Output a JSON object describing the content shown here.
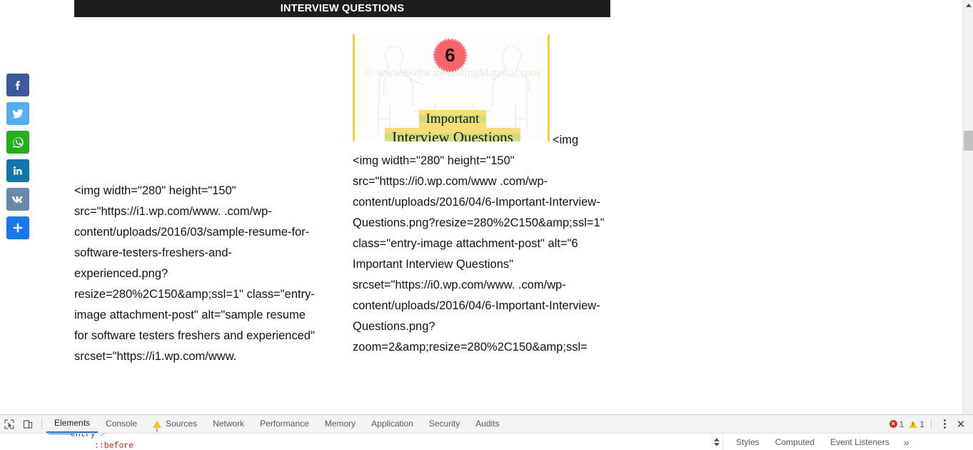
{
  "banner": {
    "title": "INTERVIEW QUESTIONS"
  },
  "social": {
    "items": [
      {
        "name": "facebook",
        "label": "Facebook",
        "color": "#3b5998",
        "glyph": "f"
      },
      {
        "name": "twitter",
        "label": "Twitter",
        "color": "#55acee",
        "glyph": "t"
      },
      {
        "name": "whatsapp",
        "label": "WhatsApp",
        "color": "#25af20",
        "glyph": "w"
      },
      {
        "name": "linkedin",
        "label": "LinkedIn",
        "color": "#0e76a8",
        "glyph": "in"
      },
      {
        "name": "vk",
        "label": "VK",
        "color": "#6989a8",
        "glyph": "vk"
      },
      {
        "name": "share-more",
        "label": "Share",
        "color": "#1877f2",
        "glyph": "+"
      }
    ]
  },
  "featured_image": {
    "alt": "6 Important Interview Questions",
    "badge_number": "6",
    "headline_line1": "Important",
    "headline_line2": "Interview Questions",
    "watermark": "© www.SoftwareTestingMaterial.com",
    "frame_color": "#f5d331",
    "badge_color": "#f9646b",
    "highlight_color": "#f7de74"
  },
  "code_left": {
    "lines": [
      "<img width=\"280\" height=\"150\"",
      "src=\"https://i1.wp.com/www.",
      "        .com/wp-",
      "content/uploads/2016/03/sample-resume-",
      "for-software-testers-freshers-and-",
      "experienced.png?",
      "resize=280%2C150&amp;ssl=1\"",
      "class=\"entry-image attachment-post\"",
      "alt=\"sample resume for software testers",
      "freshers and experienced\"",
      "srcset=\"https://i1.wp.com/www."
    ],
    "text": "<img width=\"280\" height=\"150\" src=\"https://i1.wp.com/www.        .com/wp-content/uploads/2016/03/sample-resume-for-software-testers-freshers-and-experienced.png?resize=280%2C150&amp;ssl=1\" class=\"entry-image attachment-post\" alt=\"sample resume for software testers freshers and experienced\" srcset=\"https://i1.wp.com/www."
  },
  "code_right": {
    "first_fragment": "<img",
    "lines": [
      "width=\"280\" height=\"150\"",
      "src=\"https://i0.wp.com/www",
      "        .com/wp-",
      "content/uploads/2016/04/6-Important-",
      "Interview-Questions.png?",
      "resize=280%2C150&amp;ssl=1\"",
      "class=\"entry-image attachment-post\" alt=\"6",
      "Important Interview Questions\"",
      "srcset=\"https://i0.wp.com/www.",
      "        .com/wp-",
      "content/uploads/2016/04/6-Important-",
      "Interview-Questions.png?",
      "zoom=2&amp;resize=280%2C150&amp;ssl="
    ],
    "text": "<img width=\"280\" height=\"150\" src=\"https://i0.wp.com/www        .com/wp-content/uploads/2016/04/6-Important-Interview-Questions.png?resize=280%2C150&amp;ssl=1\" class=\"entry-image attachment-post\" alt=\"6 Important Interview Questions\" srcset=\"https://i0.wp.com/www.        .com/wp-content/uploads/2016/04/6-Important-Interview-Questions.png?zoom=2&amp;resize=280%2C150&amp;ssl="
  },
  "devtools": {
    "tabs": [
      {
        "label": "Elements",
        "active": true,
        "warn": false
      },
      {
        "label": "Console",
        "active": false,
        "warn": false
      },
      {
        "label": "Sources",
        "active": false,
        "warn": true
      },
      {
        "label": "Network",
        "active": false,
        "warn": false
      },
      {
        "label": "Performance",
        "active": false,
        "warn": false
      },
      {
        "label": "Memory",
        "active": false,
        "warn": false
      },
      {
        "label": "Application",
        "active": false,
        "warn": false
      },
      {
        "label": "Security",
        "active": false,
        "warn": false
      },
      {
        "label": "Audits",
        "active": false,
        "warn": false
      }
    ],
    "error_count": "1",
    "warning_count": "1",
    "dom_lines": {
      "line1": "entry",
      "line1_arrow": ">",
      "line2": "::before"
    },
    "sidebar_tabs": [
      {
        "label": "Styles"
      },
      {
        "label": "Computed"
      },
      {
        "label": "Event Listeners"
      }
    ],
    "sidebar_more": "»",
    "error_color": "#d93025",
    "warning_color": "#f5c518",
    "accent_color": "#1772e5"
  }
}
